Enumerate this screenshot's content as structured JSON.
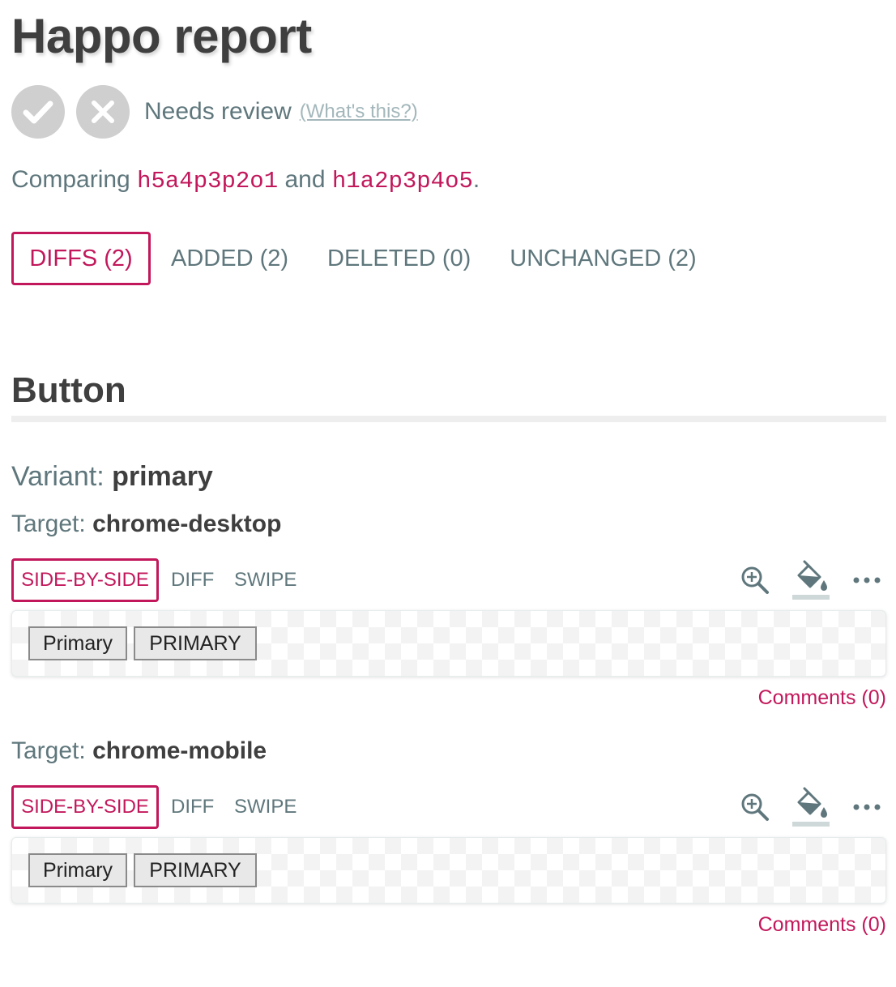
{
  "header": {
    "title": "Happo report"
  },
  "status": {
    "label": "Needs review",
    "help_link": "(What's this?)"
  },
  "comparison": {
    "prefix": "Comparing",
    "sha_before": "h5a4p3p2o1",
    "conjunction": "and",
    "sha_after": "h1a2p3p4o5",
    "suffix": "."
  },
  "tabs": [
    {
      "label": "DIFFS (2)",
      "active": true
    },
    {
      "label": "ADDED (2)",
      "active": false
    },
    {
      "label": "DELETED (0)",
      "active": false
    },
    {
      "label": "UNCHANGED (2)",
      "active": false
    }
  ],
  "section": {
    "title": "Button",
    "variant_label": "Variant:",
    "variant_value": "primary",
    "targets": [
      {
        "label": "Target:",
        "name": "chrome-desktop",
        "views": [
          "SIDE-BY-SIDE",
          "DIFF",
          "SWIPE"
        ],
        "active_view": "SIDE-BY-SIDE",
        "tools": [
          "zoom-in-icon",
          "fill-color-icon",
          "more-icon"
        ],
        "screenshot_buttons": [
          "Primary",
          "PRIMARY"
        ],
        "comments": "Comments (0)"
      },
      {
        "label": "Target:",
        "name": "chrome-mobile",
        "views": [
          "SIDE-BY-SIDE",
          "DIFF",
          "SWIPE"
        ],
        "active_view": "SIDE-BY-SIDE",
        "tools": [
          "zoom-in-icon",
          "fill-color-icon",
          "more-icon"
        ],
        "screenshot_buttons": [
          "Primary",
          "PRIMARY"
        ],
        "comments": "Comments (0)"
      }
    ]
  },
  "colors": {
    "accent": "#c2185b",
    "text": "#5f777c",
    "heading": "#3f3f3f",
    "icon_circle": "#cfcfcf"
  }
}
